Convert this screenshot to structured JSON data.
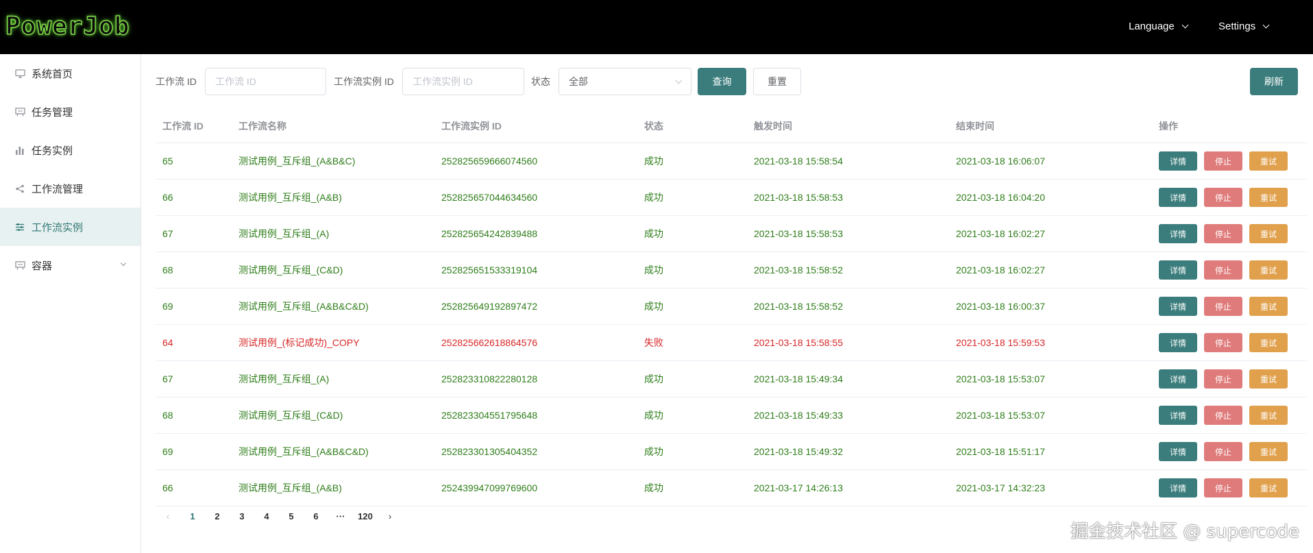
{
  "header": {
    "logo": "PowerJob",
    "language_label": "Language",
    "settings_label": "Settings"
  },
  "sidebar": {
    "items": [
      {
        "label": "系统首页",
        "icon": "monitor-icon"
      },
      {
        "label": "任务管理",
        "icon": "presentation-icon"
      },
      {
        "label": "任务实例",
        "icon": "bar-chart-icon"
      },
      {
        "label": "工作流管理",
        "icon": "share-icon"
      },
      {
        "label": "工作流实例",
        "icon": "sliders-icon",
        "active": true
      },
      {
        "label": "容器",
        "icon": "presentation-icon",
        "expandable": true
      }
    ]
  },
  "filters": {
    "workflow_id_label": "工作流 ID",
    "workflow_id_placeholder": "工作流 ID",
    "workflow_instance_id_label": "工作流实例 ID",
    "workflow_instance_id_placeholder": "工作流实例 ID",
    "status_label": "状态",
    "status_value": "全部",
    "query_button": "查询",
    "reset_button": "重置",
    "refresh_button": "刷新"
  },
  "table": {
    "columns": [
      "工作流 ID",
      "工作流名称",
      "工作流实例 ID",
      "状态",
      "触发时间",
      "结束时间",
      "操作"
    ],
    "action_labels": {
      "detail": "详情",
      "stop": "停止",
      "retry": "重试"
    },
    "rows": [
      {
        "id": "65",
        "name": "测试用例_互斥组_(A&B&C)",
        "instance_id": "252825659666074560",
        "status": "成功",
        "trigger": "2021-03-18 15:58:54",
        "end": "2021-03-18 16:06:07",
        "ok": true
      },
      {
        "id": "66",
        "name": "测试用例_互斥组_(A&B)",
        "instance_id": "252825657044634560",
        "status": "成功",
        "trigger": "2021-03-18 15:58:53",
        "end": "2021-03-18 16:04:20",
        "ok": true
      },
      {
        "id": "67",
        "name": "测试用例_互斥组_(A)",
        "instance_id": "252825654242839488",
        "status": "成功",
        "trigger": "2021-03-18 15:58:53",
        "end": "2021-03-18 16:02:27",
        "ok": true
      },
      {
        "id": "68",
        "name": "测试用例_互斥组_(C&D)",
        "instance_id": "252825651533319104",
        "status": "成功",
        "trigger": "2021-03-18 15:58:52",
        "end": "2021-03-18 16:02:27",
        "ok": true
      },
      {
        "id": "69",
        "name": "测试用例_互斥组_(A&B&C&D)",
        "instance_id": "252825649192897472",
        "status": "成功",
        "trigger": "2021-03-18 15:58:52",
        "end": "2021-03-18 16:00:37",
        "ok": true
      },
      {
        "id": "64",
        "name": "测试用例_(标记成功)_COPY",
        "instance_id": "252825662618864576",
        "status": "失败",
        "trigger": "2021-03-18 15:58:55",
        "end": "2021-03-18 15:59:53",
        "ok": false
      },
      {
        "id": "67",
        "name": "测试用例_互斥组_(A)",
        "instance_id": "252823310822280128",
        "status": "成功",
        "trigger": "2021-03-18 15:49:34",
        "end": "2021-03-18 15:53:07",
        "ok": true
      },
      {
        "id": "68",
        "name": "测试用例_互斥组_(C&D)",
        "instance_id": "252823304551795648",
        "status": "成功",
        "trigger": "2021-03-18 15:49:33",
        "end": "2021-03-18 15:53:07",
        "ok": true
      },
      {
        "id": "69",
        "name": "测试用例_互斥组_(A&B&C&D)",
        "instance_id": "252823301305404352",
        "status": "成功",
        "trigger": "2021-03-18 15:49:32",
        "end": "2021-03-18 15:51:17",
        "ok": true
      },
      {
        "id": "66",
        "name": "测试用例_互斥组_(A&B)",
        "instance_id": "252439947099769600",
        "status": "成功",
        "trigger": "2021-03-17 14:26:13",
        "end": "2021-03-17 14:32:23",
        "ok": true
      }
    ]
  },
  "pagination": {
    "pages": [
      "1",
      "2",
      "3",
      "4",
      "5",
      "6",
      "···",
      "120"
    ],
    "current": "1"
  },
  "watermark": "掘金技术社区 @ supercode",
  "colors": {
    "accent": "#3b7d7c",
    "success_text": "#2e7d19",
    "fail_text": "#d82626",
    "stop_button": "#e07b7b",
    "retry_button": "#e0a04c"
  }
}
